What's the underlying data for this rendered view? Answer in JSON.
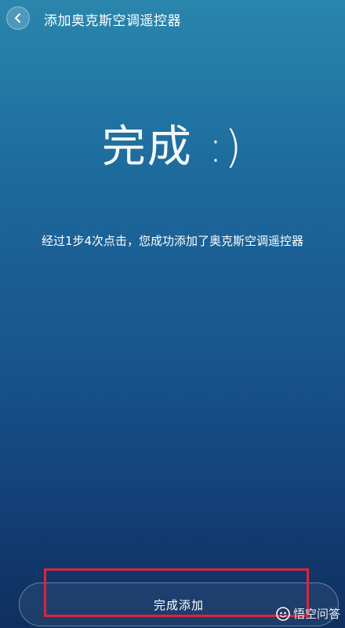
{
  "header": {
    "title": "添加奥克斯空调遥控器"
  },
  "main": {
    "headline": "完成 :)",
    "summary": "经过1步4次点击，您成功添加了奥克斯空调遥控器"
  },
  "footer": {
    "finish_label": "完成添加"
  },
  "watermark": {
    "text": "悟空问答"
  },
  "colors": {
    "highlight": "#d7263d",
    "gradient_top": "#2a86ad",
    "gradient_bottom": "#0f2f5e"
  },
  "icons": {
    "back": "chevron-left-icon",
    "watermark_logo": "wukong-logo-icon"
  }
}
